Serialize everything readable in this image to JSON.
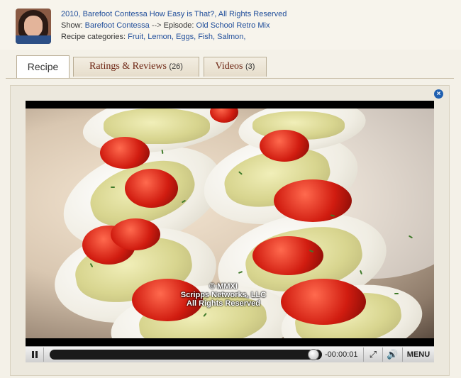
{
  "header": {
    "title": "2010, Barefoot Contessa How Easy is That?, All Rights Reserved",
    "show_prefix": "Show:",
    "show_name": "Barefoot Contessa",
    "episode_arrow": "-->",
    "episode_prefix": "Episode:",
    "episode_name": "Old School Retro Mix",
    "categories_prefix": "Recipe categories:",
    "categories": "Fruit, Lemon, Eggs, Fish, Salmon,"
  },
  "tabs": [
    {
      "label": "Recipe",
      "count": ""
    },
    {
      "label": "Ratings & Reviews",
      "count": "(26)"
    },
    {
      "label": "Videos",
      "count": "(3)"
    }
  ],
  "video": {
    "watermark_line1": "© MMXI",
    "watermark_line2": "Scripps Networks, LLC",
    "watermark_line3": "All Rights Reserved",
    "progress_fraction": 0.97
  },
  "controls": {
    "time": "-00:00:01",
    "menu_label": "MENU",
    "fullscreen_icon": "⤢",
    "volume_icon": "🔊"
  },
  "close_icon": "×",
  "colors": {
    "link": "#1f4d9a",
    "tab_text": "#6b2210",
    "close": "#1f5fb0"
  }
}
